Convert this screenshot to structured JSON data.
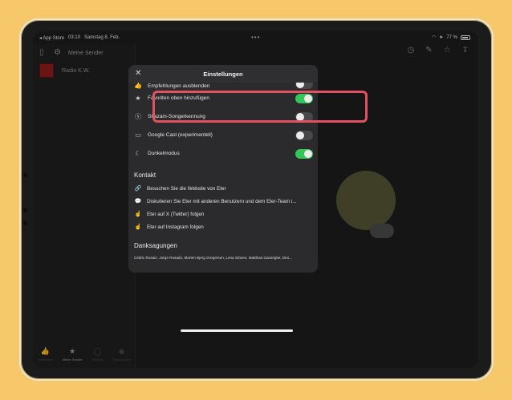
{
  "status": {
    "back_app": "◂ App Store",
    "time": "03:10",
    "date": "Samstag 8. Feb.",
    "battery": "77 %"
  },
  "sidebar": {
    "title": "Meine Sender",
    "station": "Radio K.W."
  },
  "tabbar": {
    "items": [
      {
        "label": "Entdecken"
      },
      {
        "label": "Meine Sender"
      },
      {
        "label": "Suchen"
      },
      {
        "label": "Radiowecker"
      }
    ]
  },
  "sheet": {
    "title": "Einstellungen",
    "toggles": [
      {
        "label": "Empfehlungen ausblenden",
        "on": false
      },
      {
        "label": "Favoriten oben hinzufügen",
        "on": true
      },
      {
        "label": "Shazam-Songerkennung",
        "on": false
      },
      {
        "label": "Google Cast (experimentell)",
        "on": false
      },
      {
        "label": "Dunkelmodus",
        "on": true
      }
    ],
    "contact_header": "Kontakt",
    "links": [
      {
        "label": "Besuchen Sie die Website von Eter"
      },
      {
        "label": "Diskutieren Sie Eter mit anderen Benutzern und dem Eter-Team i..."
      },
      {
        "label": "Eter auf X (Twitter) folgen"
      },
      {
        "label": "Eter auf Instagram folgen"
      }
    ],
    "credits_header": "Danksagungen",
    "credits": "Cédric Rozain, Jorge Rosado, Morten Bjerg Gregersen, Lena Stöxen, Matthias Gansrigler, Dmi..."
  },
  "colors": {
    "background": "#f6c86a",
    "highlight": "#e0525f",
    "toggle_on": "#33c759"
  }
}
